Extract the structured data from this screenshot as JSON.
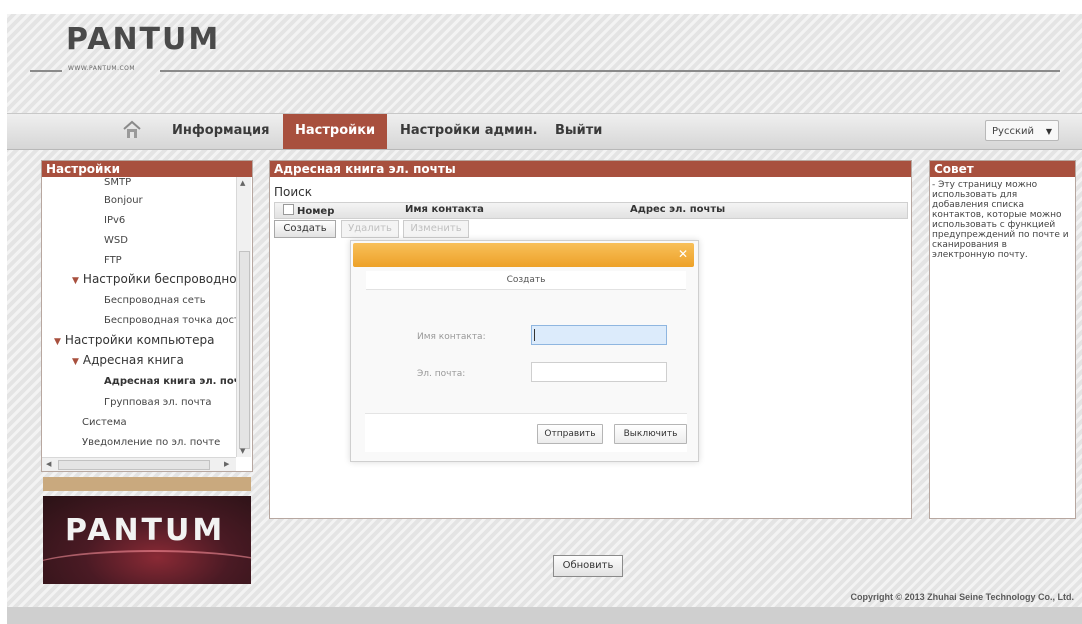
{
  "brand": {
    "logo_text": "PANTUM",
    "url": "WWW.PANTUM.COM"
  },
  "nav": {
    "home_icon": "home-icon",
    "items": [
      {
        "label": "Информация",
        "active": false
      },
      {
        "label": "Настройки",
        "active": true
      },
      {
        "label": "Настройки админ.",
        "active": false
      },
      {
        "label": "Выйти",
        "active": false
      }
    ],
    "language": "Русский"
  },
  "sidebar": {
    "title": "Настройки",
    "items": [
      {
        "label": "SMTP"
      },
      {
        "label": "Bonjour"
      },
      {
        "label": "IPv6"
      },
      {
        "label": "WSD"
      },
      {
        "label": "FTP"
      },
      {
        "label": "Настройки беспроводной с"
      },
      {
        "label": "Беспроводная сеть"
      },
      {
        "label": "Беспроводная точка досту"
      },
      {
        "label": "Настройки компьютера"
      },
      {
        "label": "Адресная книга"
      },
      {
        "label": "Адресная книга эл. поч"
      },
      {
        "label": "Групповая эл. почта"
      },
      {
        "label": "Система"
      },
      {
        "label": "Уведомление по эл. почте"
      }
    ]
  },
  "main": {
    "title": "Адресная книга эл. почты",
    "search_label": "Поиск",
    "columns": [
      "Номер",
      "Имя контакта",
      "Адрес эл. почты"
    ],
    "buttons": {
      "create": "Создать",
      "delete": "Удалить",
      "edit": "Изменить"
    }
  },
  "tip": {
    "title": "Совет",
    "text": "- Эту страницу можно использовать для добавления списка контактов, которые можно использовать с функцией предупреждений по почте и сканирования в электронную почту."
  },
  "modal": {
    "tab": "Создать",
    "contact_label": "Имя контакта:",
    "contact_value": "",
    "email_label": "Эл. почта:",
    "email_value": "",
    "submit": "Отправить",
    "cancel": "Выключить",
    "close_icon": "close-icon"
  },
  "refresh_label": "Обновить",
  "copyright": "Copyright © 2013 Zhuhai Seine Technology Co., Ltd.",
  "colors": {
    "accent": "#a8503e",
    "modal_bar": "#f2b03c"
  }
}
